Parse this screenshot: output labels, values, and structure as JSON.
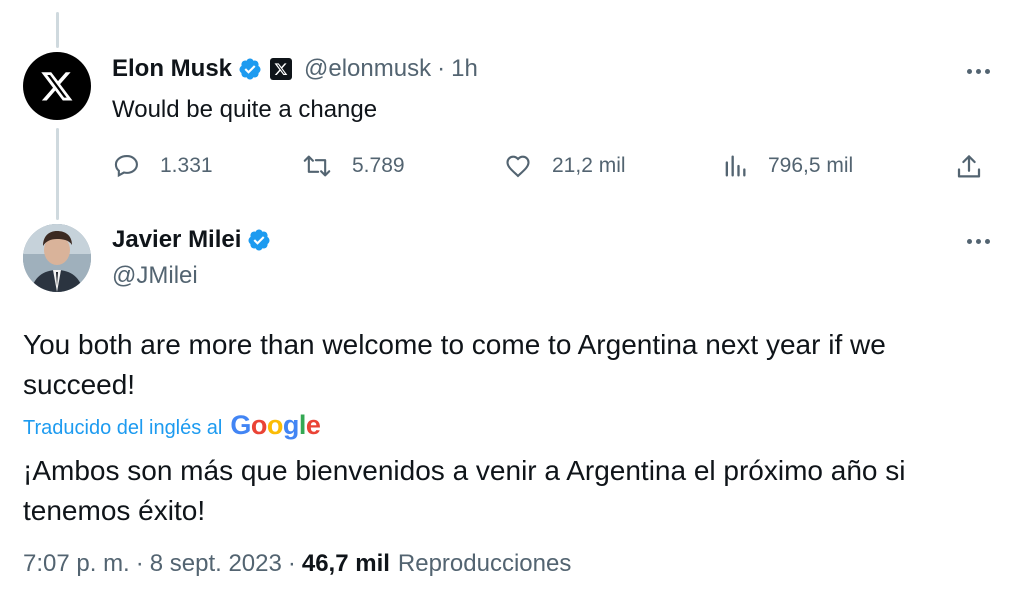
{
  "tweet1": {
    "avatar_icon": "x-logo-icon",
    "name": "Elon Musk",
    "handle": "@elonmusk",
    "separator": "·",
    "time": "1h",
    "text": "Would be quite a change",
    "actions": {
      "replies": "1.331",
      "reposts": "5.789",
      "likes": "21,2 mil",
      "views": "796,5 mil"
    }
  },
  "tweet2": {
    "name": "Javier Milei",
    "handle": "@JMilei",
    "text": "You both are more than welcome to come to Argentina next year if we succeed!",
    "translated_label": "Traducido del inglés al",
    "translation_brand": "Google",
    "translation": "¡Ambos son más que bienvenidos a venir a Argentina el próximo año si tenemos éxito!",
    "time": "7:07 p. m.",
    "sep1": "·",
    "date": "8 sept. 2023",
    "sep2": "·",
    "views_count": "46,7 mil",
    "views_label": "Reproducciones"
  },
  "colors": {
    "text": "#0f1419",
    "secondary": "#536471",
    "link": "#1d9bf0",
    "verified": "#1d9bf0"
  }
}
